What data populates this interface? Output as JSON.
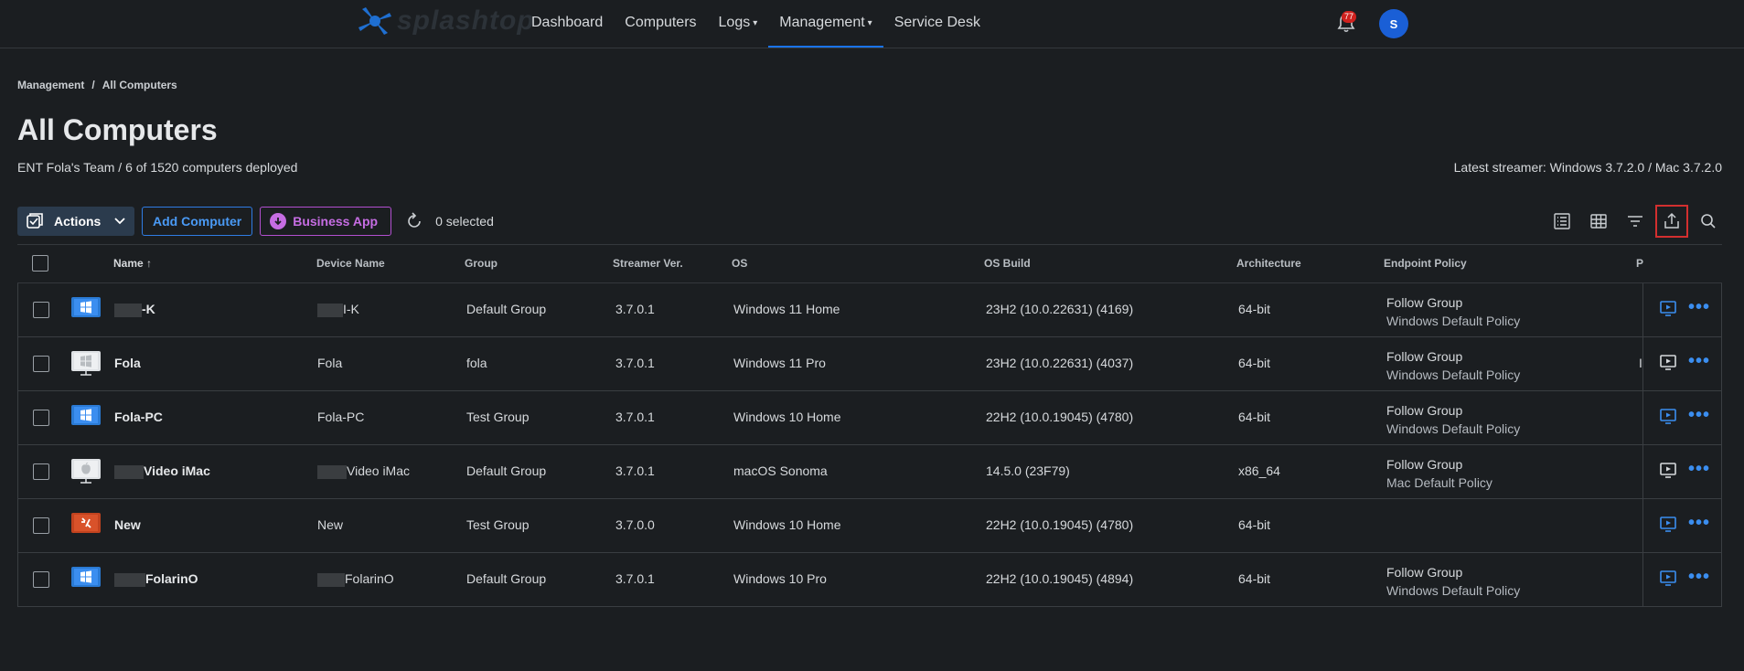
{
  "header": {
    "logo_text": "splashtop",
    "nav": [
      {
        "label": "Dashboard",
        "caret": ""
      },
      {
        "label": "Computers",
        "caret": ""
      },
      {
        "label": "Logs",
        "caret": "▾"
      },
      {
        "label": "Management",
        "caret": "▾"
      },
      {
        "label": "Service Desk",
        "caret": ""
      }
    ],
    "notification_count": "77",
    "avatar_initial": "S"
  },
  "breadcrumb": {
    "items": [
      "Management",
      "All Computers"
    ],
    "separator": "/"
  },
  "page": {
    "title": "All Computers",
    "subtitle": "ENT Fola's Team / 6 of 1520 computers deployed",
    "latest_streamer": "Latest streamer: Windows 3.7.2.0 / Mac 3.7.2.0"
  },
  "toolbar": {
    "actions_label": "Actions",
    "add_computer_label": "Add Computer",
    "business_app_label": "Business App",
    "selected_text": "0 selected",
    "icons": [
      "list-view-icon",
      "grid-view-icon",
      "filter-icon",
      "export-icon",
      "search-icon"
    ]
  },
  "table": {
    "columns": [
      "Name ↑",
      "Device Name",
      "Group",
      "Streamer Ver.",
      "OS",
      "OS Build",
      "Architecture",
      "Endpoint Policy",
      "P"
    ],
    "rows": [
      {
        "os_icon": "windows",
        "name": "-K",
        "name_redact": 30,
        "device": "I-K",
        "device_redact": 28,
        "group": "Default Group",
        "streamer": "3.7.0.1",
        "os": "Windows 11 Home",
        "build": "23H2 (10.0.22631) (4169)",
        "arch": "64-bit",
        "policy": "Follow Group",
        "policy_sub": "Windows Default Policy",
        "trunc": "",
        "remote": "blue"
      },
      {
        "os_icon": "windows-grey",
        "name": "Fola",
        "name_redact": 0,
        "device": "Fola",
        "device_redact": 0,
        "group": "fola",
        "streamer": "3.7.0.1",
        "os": "Windows 11 Pro",
        "build": "23H2 (10.0.22631) (4037)",
        "arch": "64-bit",
        "policy": "Follow Group",
        "policy_sub": "Windows Default Policy",
        "trunc": "I",
        "remote": "white"
      },
      {
        "os_icon": "windows",
        "name": "Fola-PC",
        "name_redact": 0,
        "device": "Fola-PC",
        "device_redact": 0,
        "group": "Test Group",
        "streamer": "3.7.0.1",
        "os": "Windows 10 Home",
        "build": "22H2 (10.0.19045) (4780)",
        "arch": "64-bit",
        "policy": "Follow Group",
        "policy_sub": "Windows Default Policy",
        "trunc": "",
        "remote": "blue"
      },
      {
        "os_icon": "mac",
        "name": "Video iMac",
        "name_redact": 32,
        "device": "Video iMac",
        "device_redact": 32,
        "group": "Default Group",
        "streamer": "3.7.0.1",
        "os": "macOS Sonoma",
        "build": "14.5.0 (23F79)",
        "arch": "x86_64",
        "policy": "Follow Group",
        "policy_sub": "Mac Default Policy",
        "trunc": "",
        "remote": "white"
      },
      {
        "os_icon": "windows-broken",
        "name": "New",
        "name_redact": 0,
        "device": "New",
        "device_redact": 0,
        "group": "Test Group",
        "streamer": "3.7.0.0",
        "os": "Windows 10 Home",
        "build": "22H2 (10.0.19045) (4780)",
        "arch": "64-bit",
        "policy": "",
        "policy_sub": "",
        "trunc": "",
        "remote": "blue"
      },
      {
        "os_icon": "windows",
        "name": "FolarinO",
        "name_redact": 34,
        "device": "FolarinO",
        "device_redact": 30,
        "group": "Default Group",
        "streamer": "3.7.0.1",
        "os": "Windows 10 Pro",
        "build": "22H2 (10.0.19045) (4894)",
        "arch": "64-bit",
        "policy": "Follow Group",
        "policy_sub": "Windows Default Policy",
        "trunc": "",
        "remote": "blue"
      }
    ]
  },
  "colors": {
    "accent": "#1a73e8",
    "link": "#3b8ef0",
    "business": "#c66de3",
    "badge": "#d0211e",
    "highlight": "#d32f2f"
  }
}
